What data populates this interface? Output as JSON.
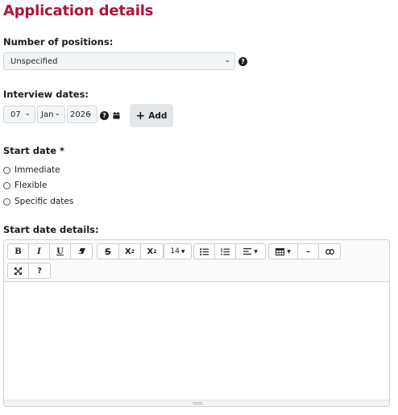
{
  "page": {
    "title": "Application details"
  },
  "positions": {
    "label": "Number of positions:",
    "selected": "Unspecified",
    "help": "?"
  },
  "interview": {
    "label": "Interview dates:",
    "day": "07",
    "month": "Jan",
    "year": "2026",
    "help": "?",
    "add_label": "Add",
    "add_icon": "+"
  },
  "start_date": {
    "label": "Start date *",
    "options": [
      "Immediate",
      "Flexible",
      "Specific dates"
    ]
  },
  "details": {
    "label": "Start date details:",
    "toolbar": {
      "bold": "B",
      "italic": "I",
      "underline": "U",
      "eraser": "eraser-icon",
      "strike": "S",
      "superscript": "X",
      "superscript_mark": "2",
      "subscript": "X",
      "subscript_mark": "2",
      "font_size": "14",
      "unordered_list": "list-ul-icon",
      "ordered_list": "list-ol-icon",
      "align": "align-left-icon",
      "table": "table-icon",
      "hr": "–",
      "link": "link-icon",
      "fullscreen": "expand-icon",
      "help": "?"
    }
  },
  "colors": {
    "accent": "#b0123b"
  }
}
